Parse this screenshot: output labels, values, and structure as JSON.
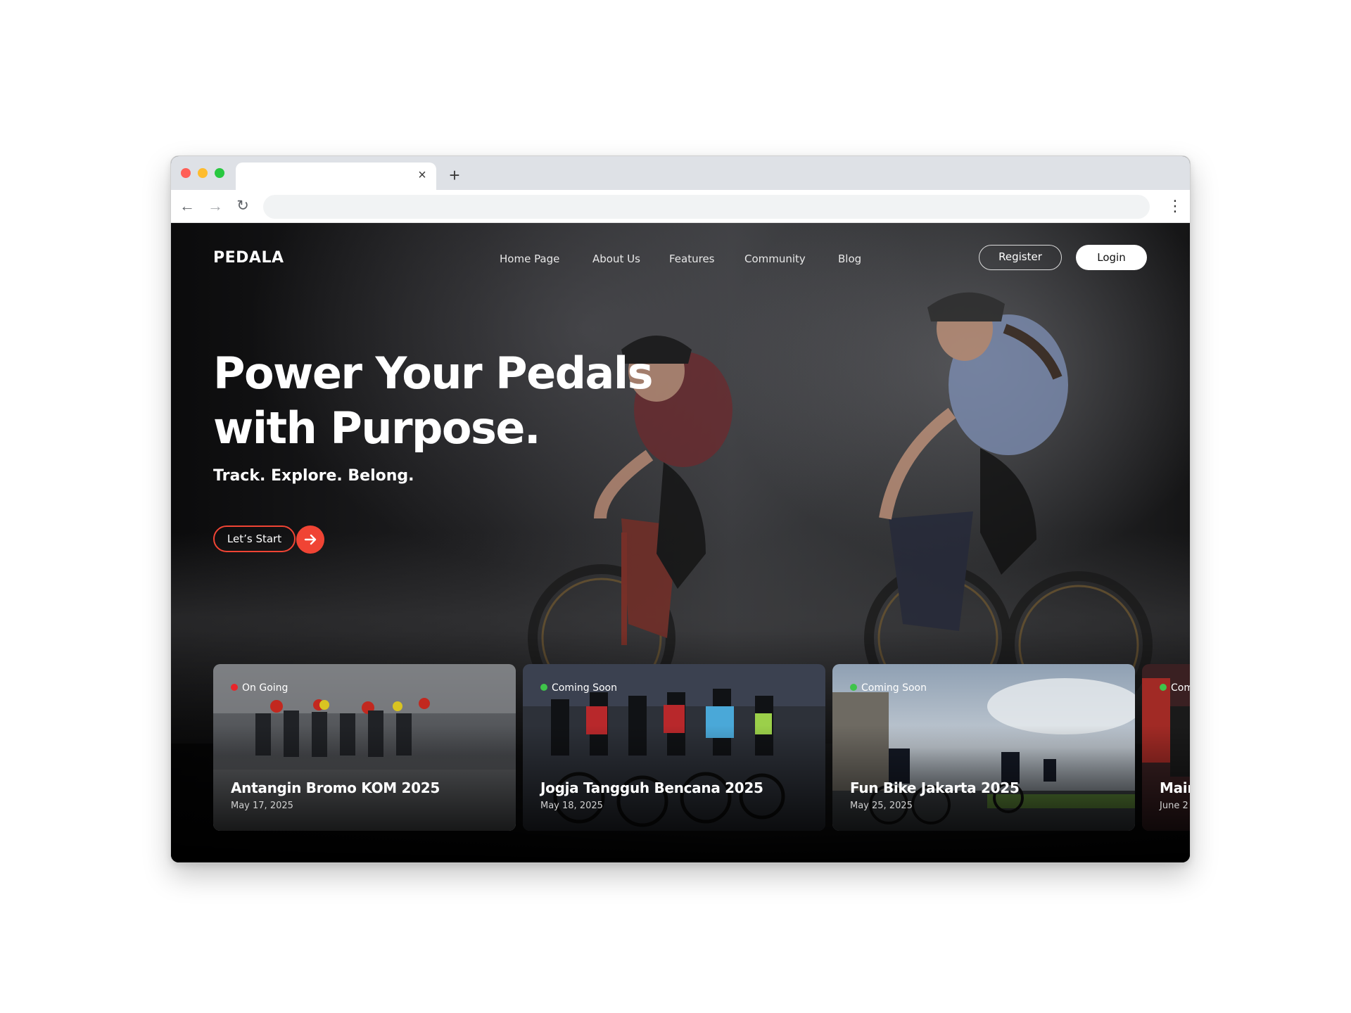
{
  "browser": {
    "tab_close_glyph": "×",
    "new_tab_glyph": "+",
    "back_glyph": "←",
    "forward_glyph": "→",
    "reload_glyph": "↻",
    "menu_glyph": "⋮"
  },
  "header": {
    "logo": "PEDALA",
    "nav": [
      {
        "label": "Home Page"
      },
      {
        "label": "About Us"
      },
      {
        "label": "Features"
      },
      {
        "label": "Community"
      },
      {
        "label": "Blog"
      }
    ],
    "register_label": "Register",
    "login_label": "Login"
  },
  "hero": {
    "title_line1": "Power Your Pedals",
    "title_line2": "with Purpose.",
    "subtitle": "Track. Explore. Belong.",
    "cta_label": "Let’s Start",
    "cta_icon": "arrow-right-icon"
  },
  "events": [
    {
      "status": "On Going",
      "status_color": "#e8252a",
      "title": "Antangin Bromo KOM 2025",
      "date": "May 17, 2025"
    },
    {
      "status": "Coming Soon",
      "status_color": "#3fc44a",
      "title": "Jogja Tangguh Bencana 2025",
      "date": "May 18, 2025"
    },
    {
      "status": "Coming Soon",
      "status_color": "#3fc44a",
      "title": "Fun Bike Jakarta 2025",
      "date": "May 25, 2025"
    },
    {
      "status": "Coming Soon",
      "status_color": "#3fc44a",
      "title": "Main",
      "date": "June 2"
    }
  ],
  "colors": {
    "accent": "#f04434"
  }
}
